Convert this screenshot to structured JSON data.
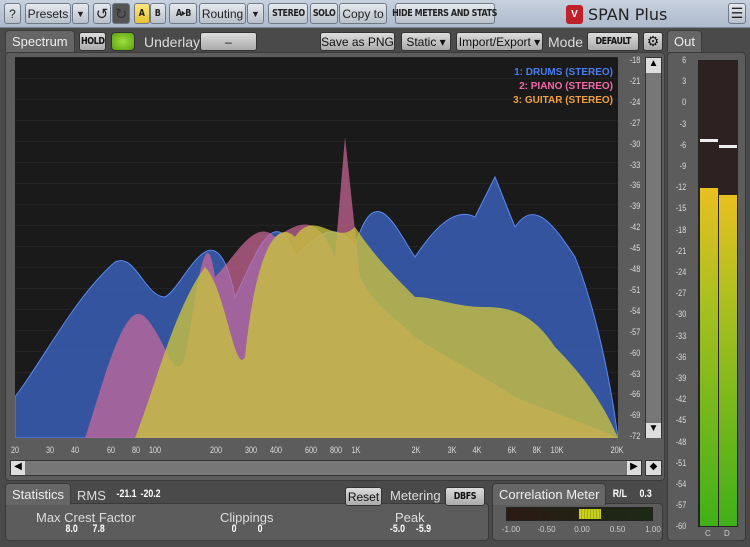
{
  "toolbar": {
    "help": "?",
    "presets": "Presets",
    "undo": "↺",
    "redo": "↻",
    "a": "A",
    "b": "B",
    "ab": "A▸B",
    "routing": "Routing",
    "stereo": "STEREO",
    "solo": "SOLO",
    "copy_to": "Copy to",
    "hide": "HIDE METERS AND STATS",
    "app_title": "SPAN Plus",
    "menu": "☰"
  },
  "spectrum": {
    "tab": "Spectrum",
    "hold": "HOLD",
    "underlay_label": "Underlay",
    "underlay_value": "–",
    "save_png": "Save as PNG",
    "static": "Static ▾",
    "import_export": "Import/Export ▾",
    "mode_label": "Mode",
    "mode_value": "DEFAULT",
    "legend": [
      {
        "label": "1: DRUMS (STEREO)",
        "color": "#4a7df0"
      },
      {
        "label": "2: PIANO (STEREO)",
        "color": "#f06aa8"
      },
      {
        "label": "3: GUITAR (STEREO)",
        "color": "#f0a040"
      }
    ],
    "db_labels": [
      "-18",
      "-21",
      "-24",
      "-27",
      "-30",
      "-33",
      "-36",
      "-39",
      "-42",
      "-45",
      "-48",
      "-51",
      "-54",
      "-57",
      "-60",
      "-63",
      "-66",
      "-69",
      "-72"
    ],
    "freq_labels": [
      [
        "20",
        20
      ],
      [
        "30",
        30
      ],
      [
        "40",
        40
      ],
      [
        "60",
        60
      ],
      [
        "80",
        80
      ],
      [
        "100",
        100
      ],
      [
        "200",
        200
      ],
      [
        "300",
        300
      ],
      [
        "400",
        400
      ],
      [
        "600",
        600
      ],
      [
        "800",
        800
      ],
      [
        "1K",
        1000
      ],
      [
        "2K",
        2000
      ],
      [
        "3K",
        3000
      ],
      [
        "4K",
        4000
      ],
      [
        "6K",
        6000
      ],
      [
        "8K",
        8000
      ],
      [
        "10K",
        10000
      ],
      [
        "20K",
        20000
      ]
    ]
  },
  "out": {
    "tab": "Out",
    "labels": [
      "6",
      "3",
      "0",
      "-3",
      "-6",
      "-9",
      "-12",
      "-15",
      "-18",
      "-21",
      "-24",
      "-27",
      "-30",
      "-33",
      "-36",
      "-39",
      "-42",
      "-45",
      "-48",
      "-51",
      "-54",
      "-57",
      "-60"
    ],
    "channels": [
      "C",
      "D"
    ],
    "level_db": [
      -12,
      -13
    ],
    "peak_db": [
      -5,
      -5.9
    ]
  },
  "stats": {
    "tab": "Statistics",
    "rms_label": "RMS",
    "rms": [
      "-21.1",
      "-20.2"
    ],
    "reset": "Reset",
    "metering_label": "Metering",
    "metering_value": "DBFS",
    "crest_label": "Max Crest Factor",
    "crest": [
      "8.0",
      "7.8"
    ],
    "clip_label": "Clippings",
    "clip": [
      "0",
      "0"
    ],
    "peak_label": "Peak",
    "peak": [
      "-5.0",
      "-5.9"
    ]
  },
  "corr": {
    "tab": "Correlation Meter",
    "rl_label": "R/L",
    "rl_value": "0.3",
    "scale": [
      "-1.00",
      "-0.50",
      "0.00",
      "0.50",
      "1.00"
    ],
    "value": 0.3
  }
}
